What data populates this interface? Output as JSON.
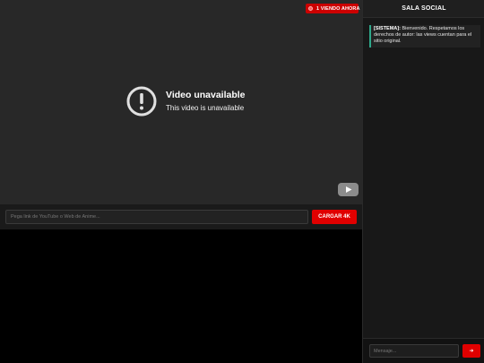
{
  "player": {
    "live_badge": "1 VIENDO AHORA",
    "unavailable_title": "Video unavailable",
    "unavailable_subtitle": "This video is unavailable",
    "logo_icon": "youtube-play-icon",
    "status_icon": "exclamation-circle-icon"
  },
  "loader": {
    "input_placeholder": "Pega link de YouTube o Web de Anime...",
    "input_value": "",
    "button_label": "CARGAR 4K"
  },
  "sidebar": {
    "title": "SALA SOCIAL",
    "messages": [
      {
        "sender": "[SISTEMA]:",
        "text": " Bienvenido. Respetamos los derechos de autor: las views cuentan para el sitio original."
      }
    ],
    "message_placeholder": "Mensaje...",
    "message_value": "",
    "send_icon": "send-arrow-icon",
    "send_symbol": "➜"
  },
  "colors": {
    "accent_red": "#e00000",
    "system_border": "#2ea88a",
    "player_bg": "#282828",
    "sidebar_bg": "#181818"
  }
}
